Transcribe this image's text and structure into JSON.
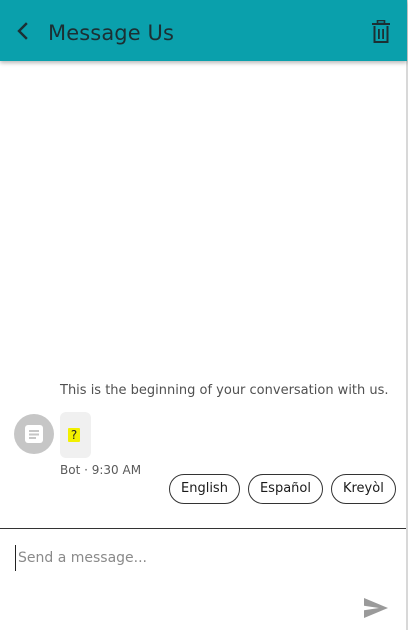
{
  "header": {
    "title": "Message Us",
    "back_icon": "chevron-left-icon",
    "delete_icon": "trash-icon",
    "background": "#0aa0ac"
  },
  "conversation": {
    "start_notice": "This is the beginning of your conversation with us.",
    "messages": [
      {
        "sender_avatar_icon": "message-icon",
        "text": "?",
        "meta": "Bot · 9:30 AM"
      }
    ],
    "quick_replies": [
      "English",
      "Español",
      "Kreyòl"
    ]
  },
  "composer": {
    "placeholder": "Send a message...",
    "value": "",
    "send_icon": "send-icon"
  }
}
